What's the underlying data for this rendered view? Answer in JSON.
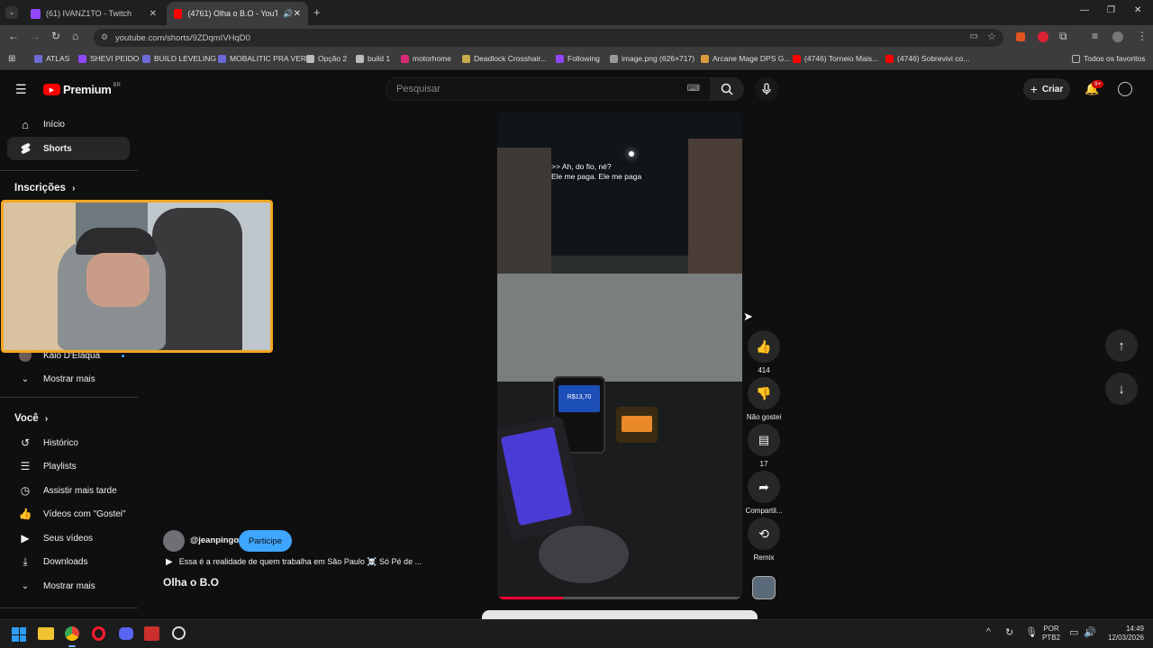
{
  "browser": {
    "tabs": [
      {
        "title": "(61) IVANZ1TO - Twitch"
      },
      {
        "title": "(4761) Olha o B.O - YouTube"
      }
    ],
    "url": "youtube.com/shorts/9ZDqmIVHqD0",
    "bookmarks": [
      "ATLAS",
      "SHEVI PEIDO",
      "BUILD LEVELING",
      "MOBALITIC PRA VER",
      "Opção 2",
      "build 1",
      "motorhome",
      "Deadlock Crosshair...",
      "Following",
      "image.png (626×717)",
      "Arcane Mage DPS G...",
      "(4746) Torneio Mais...",
      "(4746) Sobrevivi co..."
    ],
    "all_bookmarks": "Todos os favoritos"
  },
  "youtube": {
    "logo": "Premium",
    "logo_region": "BR",
    "search_placeholder": "Pesquisar",
    "create_label": "Criar",
    "notification_count": "9+"
  },
  "sidebar": {
    "home": "Início",
    "shorts": "Shorts",
    "subscriptions": "Inscrições",
    "channel": "Kaio D'Elaqua",
    "show_more_1": "Mostrar mais",
    "you": "Você",
    "history": "Histórico",
    "playlists": "Playlists",
    "watch_later": "Assistir mais tarde",
    "liked": "Vídeos com \"Gostei\"",
    "your_videos": "Seus vídeos",
    "downloads": "Downloads",
    "show_more_2": "Mostrar mais"
  },
  "short": {
    "caption_line1": ">> Ah, do fio, né?",
    "caption_line2": "Ele me paga. Ele me paga",
    "phone_price": "R$13,70",
    "channel": "@jeanpingo",
    "join_label": "Participe",
    "description": "Essa é a realidade de quem trabalha em São Paulo ☠️ Só Pé de ...",
    "title": "Olha o B.O",
    "likes": "414",
    "dislike_label": "Não gostei",
    "comments": "17",
    "share_label": "Compartil...",
    "remix_label": "Remix",
    "progress": 0.27
  },
  "taskbar": {
    "lang": "POR",
    "layout": "PTB2",
    "time": "14:49",
    "date": "12/03/2026"
  },
  "colors": {
    "youtube_red": "#ff0000",
    "join_blue": "#3ea6ff",
    "webcam_border": "#f5a623"
  }
}
